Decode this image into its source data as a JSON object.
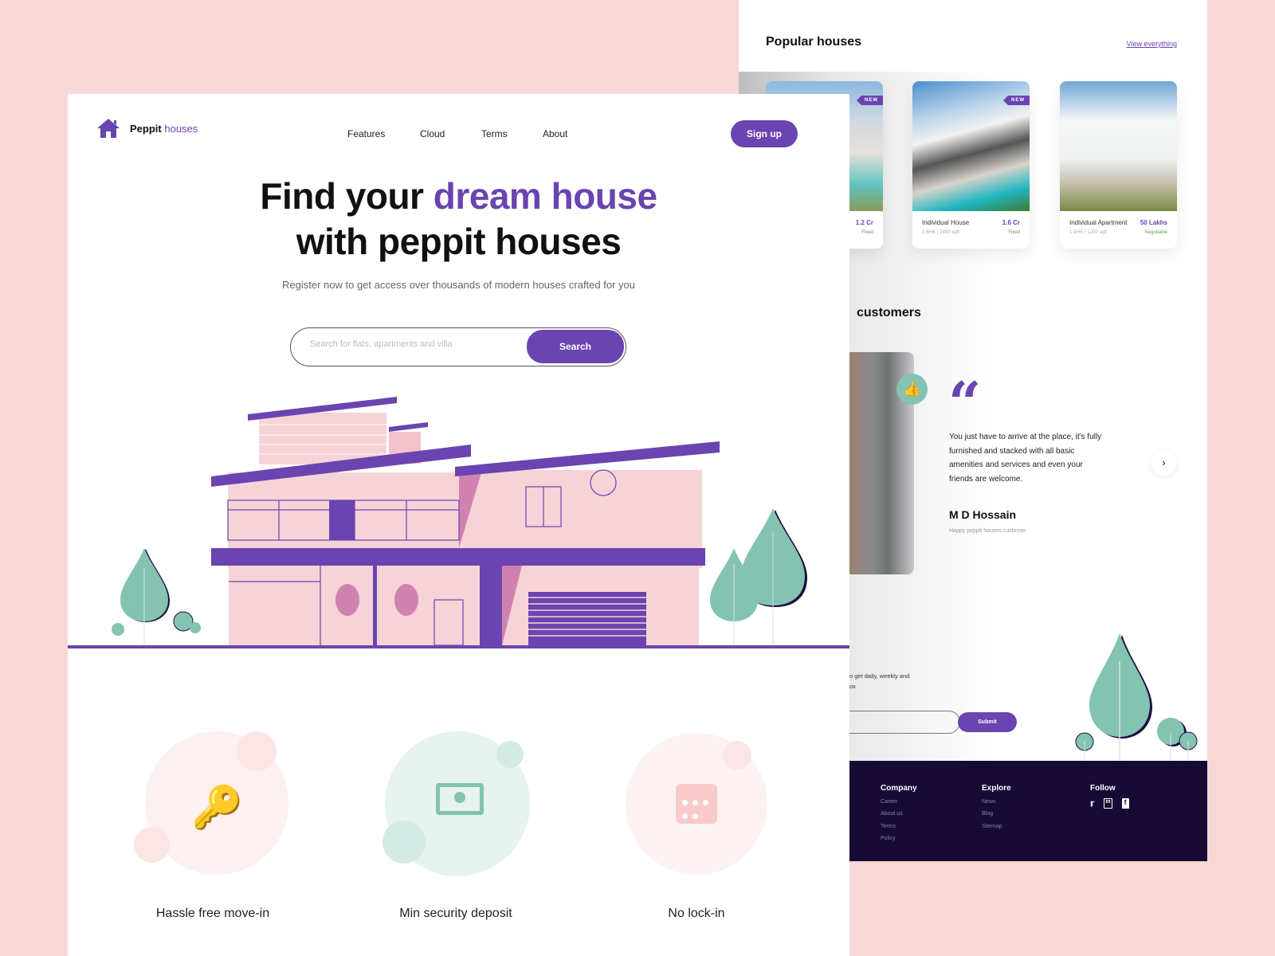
{
  "colors": {
    "accent": "#6a44b0",
    "background": "#f8d7d8",
    "mint": "#84c2b1",
    "footer": "#170a35"
  },
  "brand": {
    "name": "Peppit",
    "name_accent": "houses",
    "icon": "house-icon"
  },
  "nav": {
    "links": [
      "Features",
      "Cloud",
      "Terms",
      "About"
    ],
    "signup": "Sign up"
  },
  "hero": {
    "line1": "Find your",
    "line1_accent": "dream house",
    "line2": "with peppit houses",
    "subtitle": "Register now to get access over thousands of modern houses crafted for you",
    "search_placeholder": "Search for flats, apartments and villa",
    "search_button": "Search"
  },
  "features": [
    {
      "label": "Hassle free move-in",
      "icon": "key-icon"
    },
    {
      "label": "Min security deposit",
      "icon": "money-icon"
    },
    {
      "label": "No lock-in",
      "icon": "calendar-icon"
    }
  ],
  "popular": {
    "title": "Popular houses",
    "view_all": "View everything",
    "cards": [
      {
        "name": "",
        "price": "1.2 Cr",
        "specs": "",
        "type": "Fixed",
        "badge": "NEW"
      },
      {
        "name": "Individual House",
        "price": "1.6 Cr",
        "specs": "3 BHK | 2400 sqft",
        "type": "Fixed",
        "badge": "NEW"
      },
      {
        "name": "Individual Apartment",
        "price": "50 Lakhs",
        "specs": "1 BHK | 1200 sqft",
        "type": "Negotiable",
        "badge": ""
      }
    ]
  },
  "testimonial": {
    "heading": "customers",
    "quote": "You just have to arrive at the place, it's fully furnished and stacked with all basic amenities and services and even your friends are welcome.",
    "name": "M D Hossain",
    "role": "Happy peppit houses customer"
  },
  "newsletter": {
    "text_line1": "o get daily, weekly and",
    "text_line2": "ox",
    "submit": "Submit"
  },
  "footer": {
    "company": {
      "title": "Company",
      "links": [
        "Career",
        "About us",
        "Terms",
        "Policy"
      ]
    },
    "explore": {
      "title": "Explore",
      "links": [
        "News",
        "Blog",
        "Sitemap"
      ]
    },
    "follow": {
      "title": "Follow",
      "icons": [
        "twitter-icon",
        "linkedin-icon",
        "facebook-icon"
      ]
    }
  }
}
